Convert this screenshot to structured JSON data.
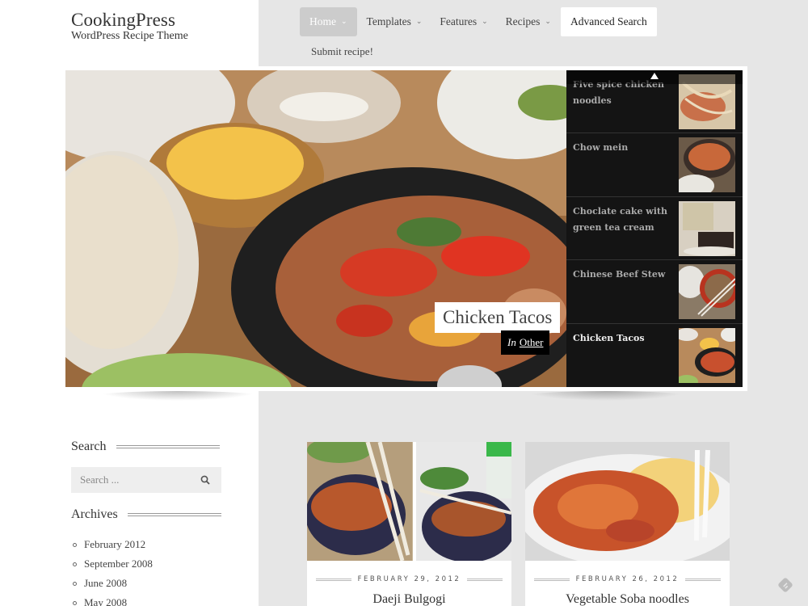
{
  "site": {
    "title": "CookingPress",
    "tagline": "WordPress Recipe Theme"
  },
  "nav": {
    "items": [
      {
        "label": "Home",
        "has_dropdown": true,
        "active": true
      },
      {
        "label": "Templates",
        "has_dropdown": true
      },
      {
        "label": "Features",
        "has_dropdown": true
      },
      {
        "label": "Recipes",
        "has_dropdown": true
      },
      {
        "label": "Advanced Search",
        "has_dropdown": false,
        "boxed": true
      }
    ],
    "second_row": {
      "label": "Submit recipe!"
    }
  },
  "slider": {
    "current": {
      "title": "Chicken Tacos",
      "category_prefix": "In",
      "category": "Other"
    },
    "scroll_up_icon": "triangle-up-icon",
    "items": [
      {
        "label": "Five spice chicken noodles",
        "active": false
      },
      {
        "label": "Chow mein",
        "active": false
      },
      {
        "label": "Choclate cake with green tea cream",
        "active": false
      },
      {
        "label": "Chinese Beef Stew",
        "active": false
      },
      {
        "label": "Chicken Tacos",
        "active": true
      }
    ]
  },
  "sidebar": {
    "search": {
      "title": "Search",
      "placeholder": "Search ...",
      "value": "",
      "icon": "search-icon"
    },
    "archives": {
      "title": "Archives",
      "items": [
        "February 2012",
        "September 2008",
        "June 2008",
        "May 2008"
      ]
    }
  },
  "posts": [
    {
      "date": "FEBRUARY 29, 2012",
      "title": "Daeji Bulgogi"
    },
    {
      "date": "FEBRUARY 26, 2012",
      "title": "Vegetable Soba noodles"
    }
  ],
  "floating": {
    "icon": "feedly-icon"
  },
  "colors": {
    "page_bg": "#e6e6e6",
    "left_column_bg": "#ffffff",
    "nav_active_bg": "#cccccc",
    "thumb_panel_bg": "#141414",
    "caption_category_bg": "#000000"
  }
}
